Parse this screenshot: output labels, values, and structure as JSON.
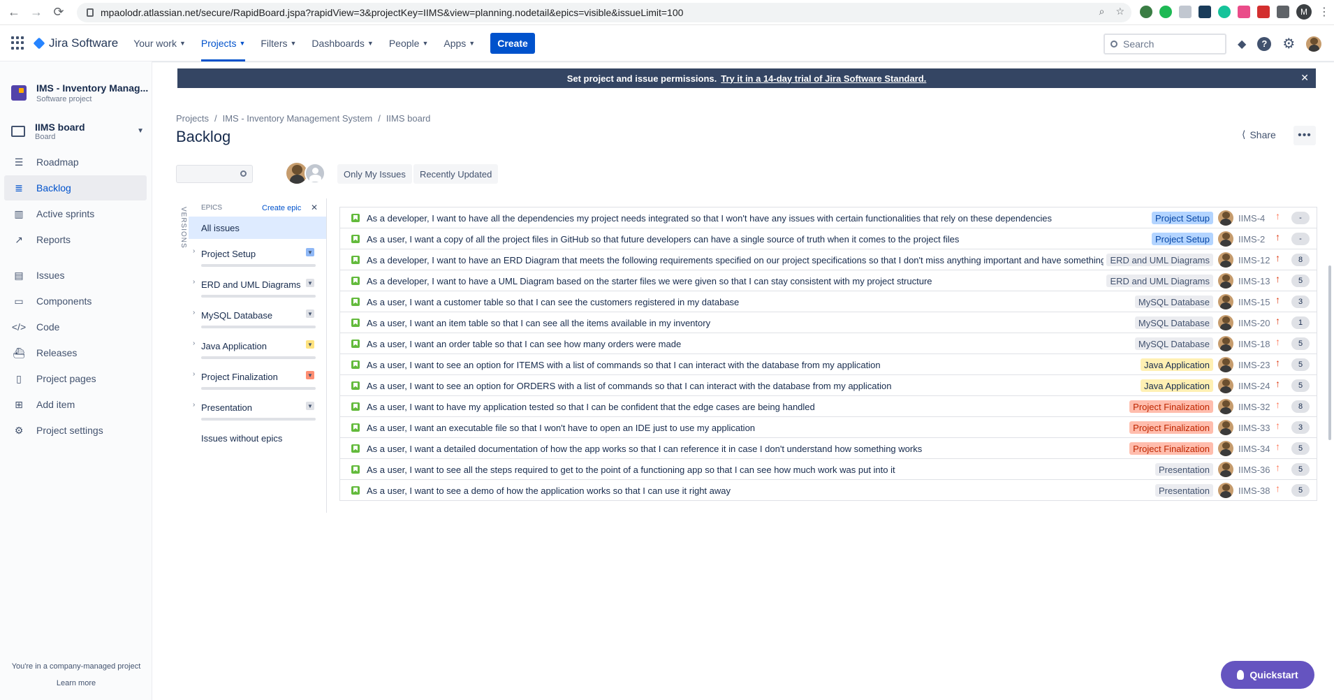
{
  "browser": {
    "url": "mpaolodr.atlassian.net/secure/RapidBoard.jspa?rapidView=3&projectKey=IIMS&view=planning.nodetail&epics=visible&issueLimit=100",
    "profile_initial": "M"
  },
  "topnav": {
    "product": "Jira Software",
    "items": [
      "Your work",
      "Projects",
      "Filters",
      "Dashboards",
      "People",
      "Apps"
    ],
    "create_label": "Create",
    "search_placeholder": "Search"
  },
  "sidebar": {
    "project_name": "IMS - Inventory Manag...",
    "project_type": "Software project",
    "board_name": "IIMS board",
    "board_sub": "Board",
    "items": [
      {
        "label": "Roadmap",
        "icon": "roadmap-icon"
      },
      {
        "label": "Backlog",
        "icon": "backlog-icon"
      },
      {
        "label": "Active sprints",
        "icon": "active-sprints-icon"
      },
      {
        "label": "Reports",
        "icon": "reports-icon"
      },
      {
        "label": "Issues",
        "icon": "issues-icon"
      },
      {
        "label": "Components",
        "icon": "components-icon"
      },
      {
        "label": "Code",
        "icon": "code-icon"
      },
      {
        "label": "Releases",
        "icon": "releases-icon"
      },
      {
        "label": "Project pages",
        "icon": "project-pages-icon"
      },
      {
        "label": "Add item",
        "icon": "add-item-icon"
      },
      {
        "label": "Project settings",
        "icon": "settings-icon"
      }
    ],
    "footer_text": "You're in a company-managed project",
    "footer_link": "Learn more"
  },
  "banner": {
    "text": "Set project and issue permissions.",
    "link": "Try it in a 14-day trial of Jira Software Standard."
  },
  "breadcrumb": [
    "Projects",
    "IMS - Inventory Management System",
    "IIMS board"
  ],
  "page_title": "Backlog",
  "share_label": "Share",
  "quick_filters": [
    "Only My Issues",
    "Recently Updated"
  ],
  "epics_panel": {
    "versions_label": "VERSIONS",
    "header": "EPICS",
    "create_label": "Create epic",
    "all_issues": "All issues",
    "epics": [
      {
        "name": "Project Setup",
        "color": "#8fb8f6"
      },
      {
        "name": "ERD and UML Diagrams",
        "color": "#dfe1e6"
      },
      {
        "name": "MySQL Database",
        "color": "#dfe1e6"
      },
      {
        "name": "Java Application",
        "color": "#ffe380"
      },
      {
        "name": "Project Finalization",
        "color": "#ff8f73"
      },
      {
        "name": "Presentation",
        "color": "#dfe1e6"
      }
    ],
    "without_epics": "Issues without epics"
  },
  "epic_colors": {
    "Project Setup": {
      "bg": "#b3d4ff",
      "fg": "#0747a6"
    },
    "ERD and UML Diagrams": {
      "bg": "#ebecf0",
      "fg": "#42526e"
    },
    "MySQL Database": {
      "bg": "#ebecf0",
      "fg": "#42526e"
    },
    "Java Application": {
      "bg": "#fff0b3",
      "fg": "#172b4d"
    },
    "Project Finalization": {
      "bg": "#ffbdad",
      "fg": "#bf2600"
    },
    "Presentation": {
      "bg": "#ebecf0",
      "fg": "#42526e"
    }
  },
  "issues": [
    {
      "summary": "As a developer, I want to have all the dependencies my project needs integrated so that I won't have any issues with certain functionalities that rely on these dependencies",
      "epic": "Project Setup",
      "key": "IIMS-4",
      "priority": "medium",
      "points": "-"
    },
    {
      "summary": "As a user, I want a copy of all the project files in GitHub so that future developers can have a single source of truth when it comes to the project files",
      "epic": "Project Setup",
      "key": "IIMS-2",
      "priority": "high",
      "points": "-"
    },
    {
      "summary": "As a developer, I want to have an ERD Diagram that meets the following requirements specified on our project specifications so that I don't miss anything important and have something I can",
      "epic": "ERD and UML Diagrams",
      "key": "IIMS-12",
      "priority": "high",
      "points": "8"
    },
    {
      "summary": "As a developer, I want to have a UML Diagram based on the starter files we were given so that I can stay consistent with my project structure",
      "epic": "ERD and UML Diagrams",
      "key": "IIMS-13",
      "priority": "high",
      "points": "5"
    },
    {
      "summary": "As a user, I want a customer table so that I can see the customers registered in my database",
      "epic": "MySQL Database",
      "key": "IIMS-15",
      "priority": "high",
      "points": "3"
    },
    {
      "summary": "As a user, I want an item table so that I can see all the items available in my inventory",
      "epic": "MySQL Database",
      "key": "IIMS-20",
      "priority": "high",
      "points": "1"
    },
    {
      "summary": "As a user, I want an order table so that I can see how many orders were made",
      "epic": "MySQL Database",
      "key": "IIMS-18",
      "priority": "medium",
      "points": "5"
    },
    {
      "summary": "As a user, I want to see an option for ITEMS with a list of commands so that I can interact with the database from my application",
      "epic": "Java Application",
      "key": "IIMS-23",
      "priority": "high",
      "points": "5"
    },
    {
      "summary": "As a user, I want to see an option for ORDERS with a list of commands so that I can interact with the database from my application",
      "epic": "Java Application",
      "key": "IIMS-24",
      "priority": "high",
      "points": "5"
    },
    {
      "summary": "As a user, I want to have my application tested so that I can be confident that the edge cases are being handled",
      "epic": "Project Finalization",
      "key": "IIMS-32",
      "priority": "medium",
      "points": "8"
    },
    {
      "summary": "As a user, I want an executable file so that I won't have to open an IDE just to use my application",
      "epic": "Project Finalization",
      "key": "IIMS-33",
      "priority": "medium",
      "points": "3"
    },
    {
      "summary": "As a user, I want a detailed documentation of how the app works so that I can reference it in case I don't understand how something works",
      "epic": "Project Finalization",
      "key": "IIMS-34",
      "priority": "medium",
      "points": "5"
    },
    {
      "summary": "As a user, I want to see all the steps required to get to the point of a functioning app so that I can see how much work was put into it",
      "epic": "Presentation",
      "key": "IIMS-36",
      "priority": "medium",
      "points": "5"
    },
    {
      "summary": "As a user, I want to see a demo of how the application works so that I can use it right away",
      "epic": "Presentation",
      "key": "IIMS-38",
      "priority": "medium",
      "points": "5"
    }
  ],
  "priority_colors": {
    "high": "#de350b",
    "medium": "#ff7452"
  },
  "quickstart_label": "Quickstart"
}
